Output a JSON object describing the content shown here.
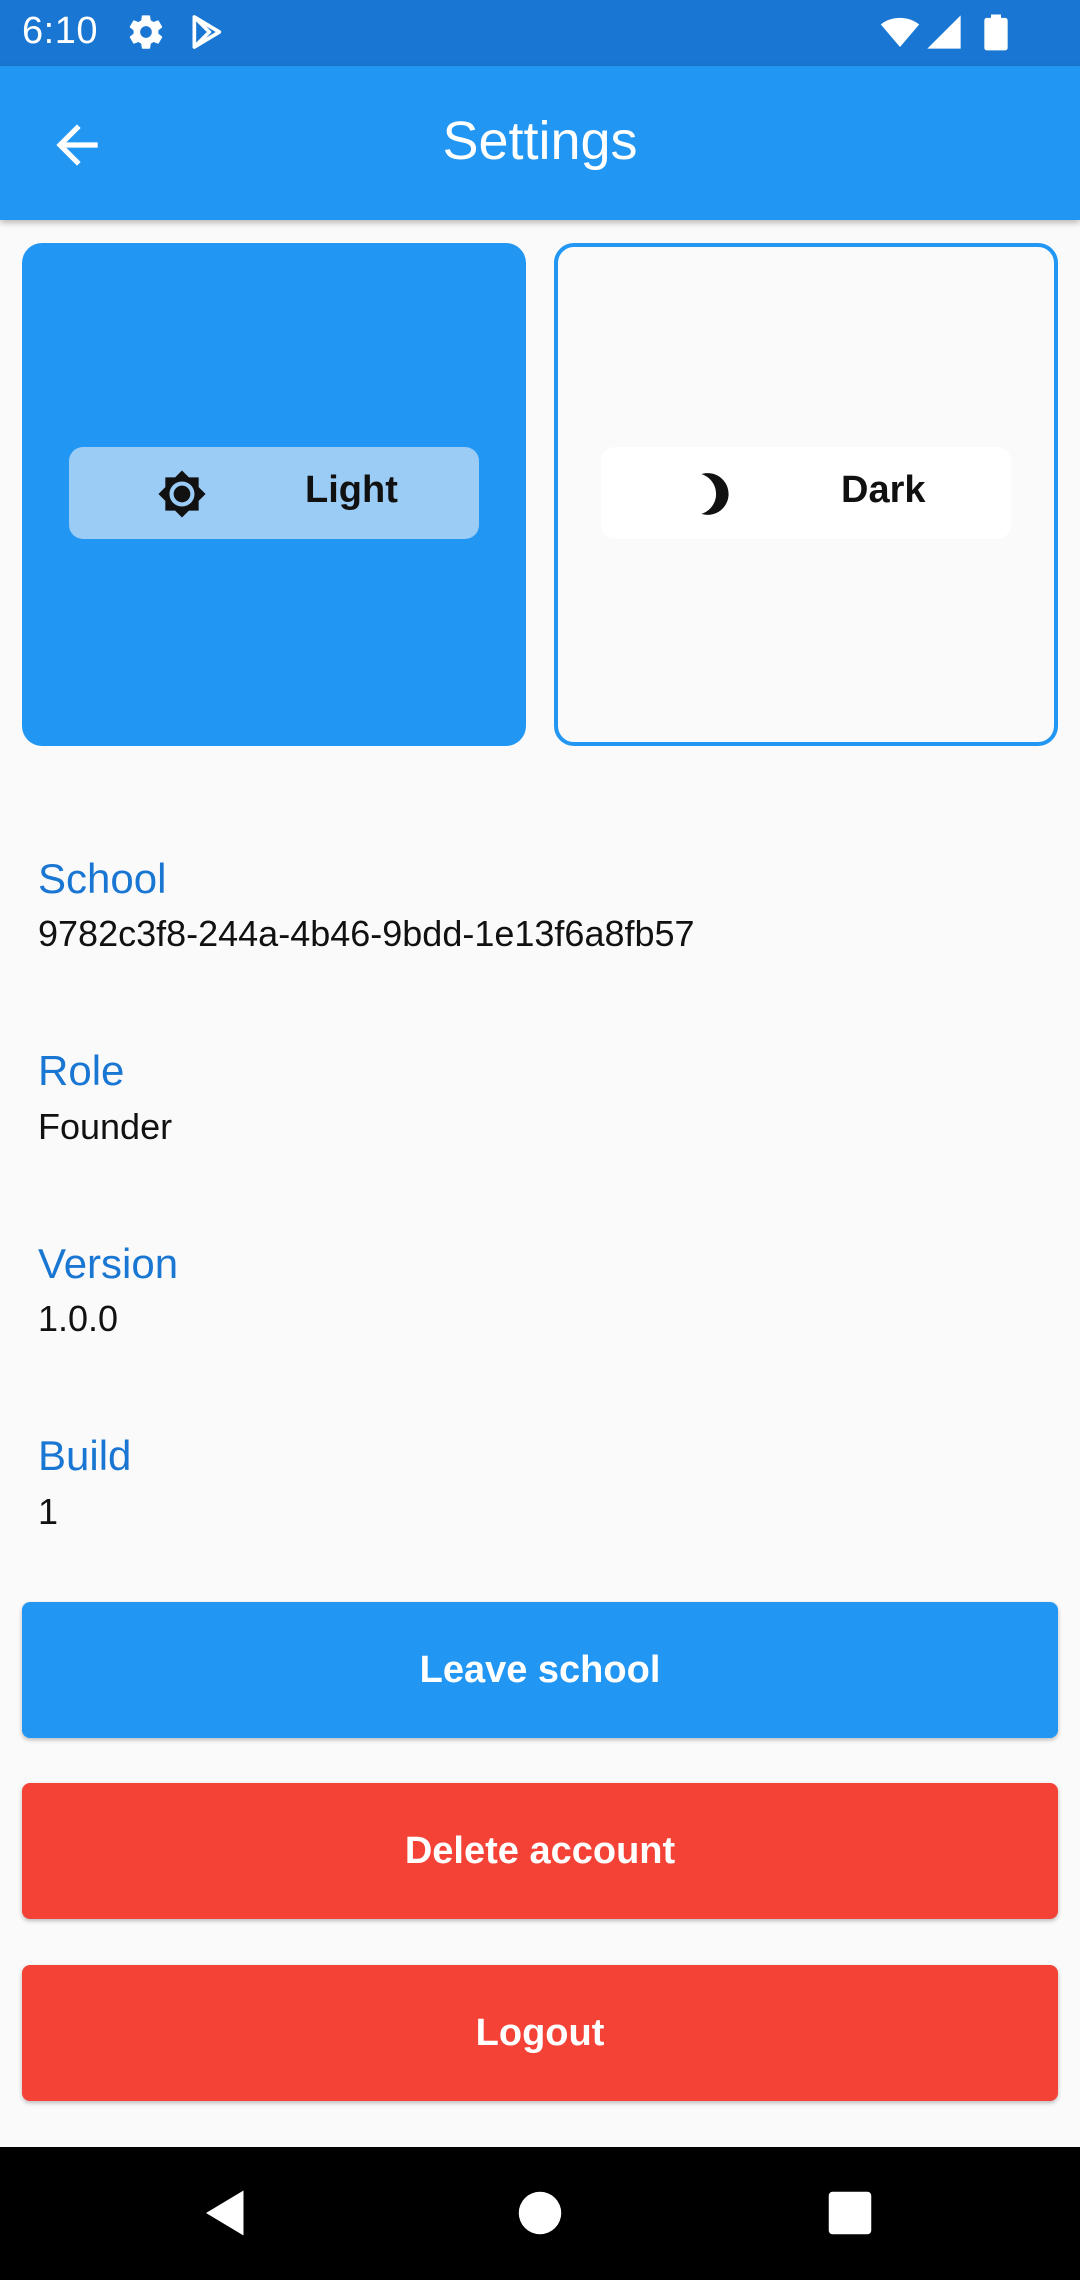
{
  "status_bar": {
    "time": "6:10",
    "icons": [
      "gear-icon",
      "play-store-icon",
      "wifi-icon",
      "signal-icon",
      "battery-icon"
    ]
  },
  "app_bar": {
    "title": "Settings",
    "back_icon": "arrow-back-icon",
    "color": "#2196f3"
  },
  "theme_options": [
    {
      "label": "Light",
      "icon": "sun-icon",
      "selected": true
    },
    {
      "label": "Dark",
      "icon": "moon-icon",
      "selected": false
    }
  ],
  "info": {
    "school": {
      "label": "School",
      "value": "9782c3f8-244a-4b46-9bdd-1e13f6a8fb57"
    },
    "role": {
      "label": "Role",
      "value": "Founder"
    },
    "version": {
      "label": "Version",
      "value": "1.0.0"
    },
    "build": {
      "label": "Build",
      "value": "1"
    }
  },
  "buttons": {
    "leave_school": "Leave school",
    "delete_account": "Delete account",
    "logout": "Logout"
  },
  "colors": {
    "primary": "#2196f3",
    "danger": "#f44336",
    "label_blue": "#1976d2"
  },
  "nav_bar": {
    "icons": [
      "back-triangle-icon",
      "home-circle-icon",
      "recents-square-icon"
    ]
  }
}
